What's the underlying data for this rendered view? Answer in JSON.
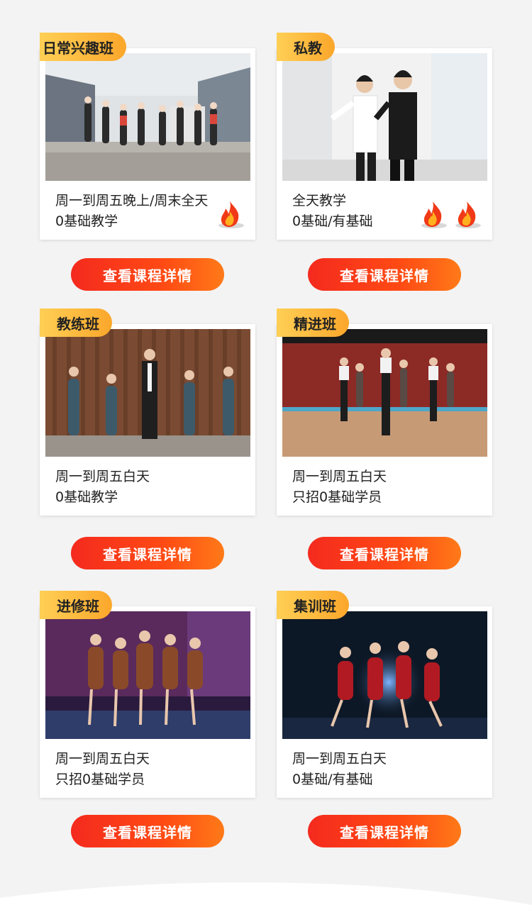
{
  "courses": [
    {
      "tag": "日常兴趣班",
      "line1": "周一到周五晚上/周末全天",
      "line2": "0基础教学",
      "flame_count": 1,
      "button": "查看课程详情"
    },
    {
      "tag": "私教",
      "line1": "全天教学",
      "line2": "0基础/有基础",
      "flame_count": 2,
      "button": "查看课程详情"
    },
    {
      "tag": "教练班",
      "line1": "周一到周五白天",
      "line2": "0基础教学",
      "flame_count": 0,
      "button": "查看课程详情"
    },
    {
      "tag": "精进班",
      "line1": "周一到周五白天",
      "line2": "只招0基础学员",
      "flame_count": 0,
      "button": "查看课程详情"
    },
    {
      "tag": "进修班",
      "line1": "周一到周五白天",
      "line2": "只招0基础学员",
      "flame_count": 0,
      "button": "查看课程详情"
    },
    {
      "tag": "集训班",
      "line1": "周一到周五白天",
      "line2": "0基础/有基础",
      "flame_count": 0,
      "button": "查看课程详情"
    }
  ],
  "colors": {
    "tag_gradient_start": "#ffcf55",
    "tag_gradient_end": "#fba72b",
    "button_gradient_start": "#f42a1e",
    "button_gradient_end": "#ff7a18",
    "page_background": "#f3f3f3"
  },
  "icons": {
    "flame": "flame-icon"
  }
}
